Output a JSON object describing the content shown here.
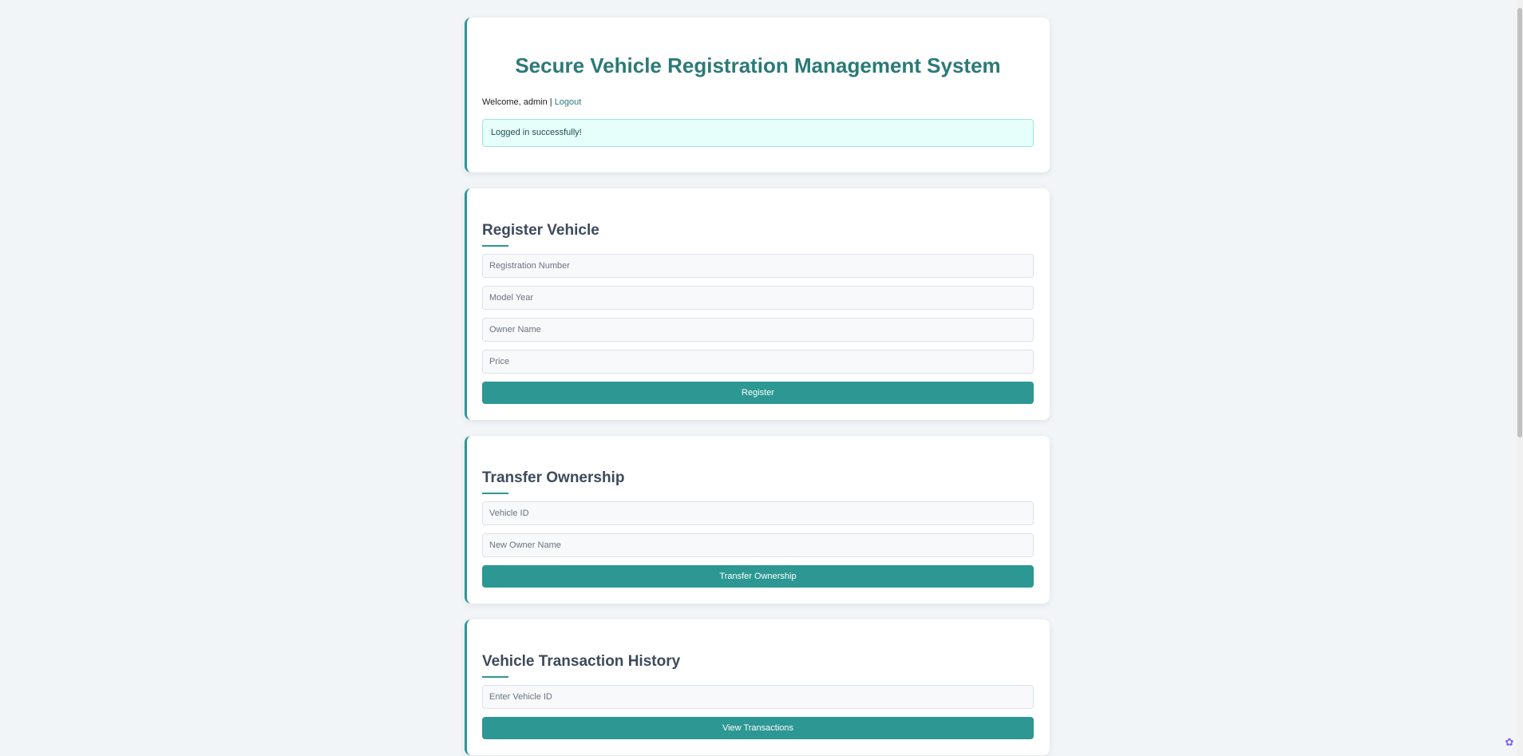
{
  "header": {
    "title": "Secure Vehicle Registration Management System",
    "welcome_text": "Welcome, admin | ",
    "logout_label": "Logout",
    "alert_message": "Logged in successfully!"
  },
  "register": {
    "title": "Register Vehicle",
    "registration_placeholder": "Registration Number",
    "model_year_placeholder": "Model Year",
    "owner_placeholder": "Owner Name",
    "price_placeholder": "Price",
    "button_label": "Register"
  },
  "transfer": {
    "title": "Transfer Ownership",
    "vehicle_id_placeholder": "Vehicle ID",
    "new_owner_placeholder": "New Owner Name",
    "button_label": "Transfer Ownership"
  },
  "history": {
    "title": "Vehicle Transaction History",
    "vehicle_id_placeholder": "Enter Vehicle ID",
    "button_label": "View Transactions"
  },
  "colors": {
    "accent": "#2c9793",
    "title": "#2b7a78",
    "background": "#f1f5f8",
    "alert_bg": "#e6fffb"
  },
  "icons": {
    "corner": "extension-icon"
  }
}
